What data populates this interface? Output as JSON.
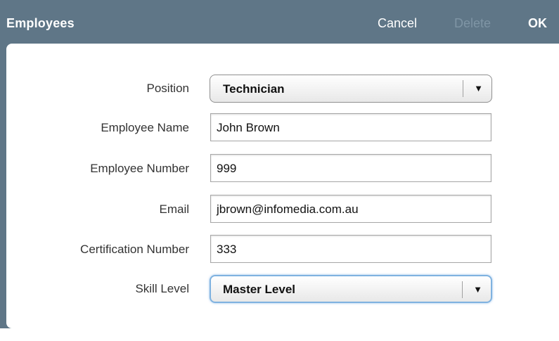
{
  "titlebar": {
    "title": "Employees",
    "cancel_label": "Cancel",
    "delete_label": "Delete",
    "ok_label": "OK"
  },
  "form": {
    "position": {
      "label": "Position",
      "value": "Technician"
    },
    "employee_name": {
      "label": "Employee Name",
      "value": "John Brown"
    },
    "employee_number": {
      "label": "Employee Number",
      "value": "999"
    },
    "email": {
      "label": "Email",
      "value": "jbrown@infomedia.com.au"
    },
    "certification_number": {
      "label": "Certification Number",
      "value": "333"
    },
    "skill_level": {
      "label": "Skill Level",
      "value": "Master Level"
    }
  },
  "icons": {
    "dropdown": "▼"
  },
  "colors": {
    "titlebar": "#5f7687",
    "disabled": "#7f95a5",
    "focus": "#7fb2e0"
  }
}
